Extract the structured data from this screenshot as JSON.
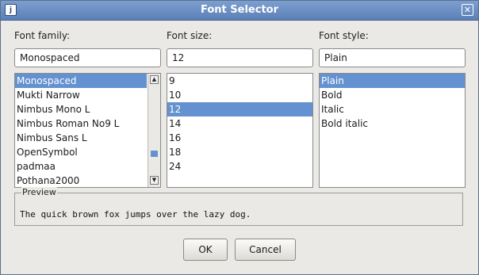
{
  "window": {
    "title": "Font Selector",
    "app_icon_glyph": "j",
    "close_glyph": "✕"
  },
  "family": {
    "label": "Font family:",
    "value": "Monospaced",
    "items": [
      "Monospaced",
      "Mukti Narrow",
      "Nimbus Mono L",
      "Nimbus Roman No9 L",
      "Nimbus Sans L",
      "OpenSymbol",
      "padmaa",
      "Pothana2000"
    ],
    "selected": "Monospaced"
  },
  "size": {
    "label": "Font size:",
    "value": "12",
    "items": [
      "9",
      "10",
      "12",
      "14",
      "16",
      "18",
      "24"
    ],
    "selected": "12"
  },
  "style": {
    "label": "Font style:",
    "value": "Plain",
    "items": [
      "Plain",
      "Bold",
      "Italic",
      "Bold italic"
    ],
    "selected": "Plain"
  },
  "preview": {
    "legend": "Preview",
    "text": "The quick brown fox jumps over the lazy dog."
  },
  "buttons": {
    "ok": "OK",
    "cancel": "Cancel"
  },
  "scrollbar": {
    "up_glyph": "▲",
    "down_glyph": "▼"
  },
  "colors": {
    "selection": "#6491cf",
    "titlebar": "#5b7fb8"
  }
}
